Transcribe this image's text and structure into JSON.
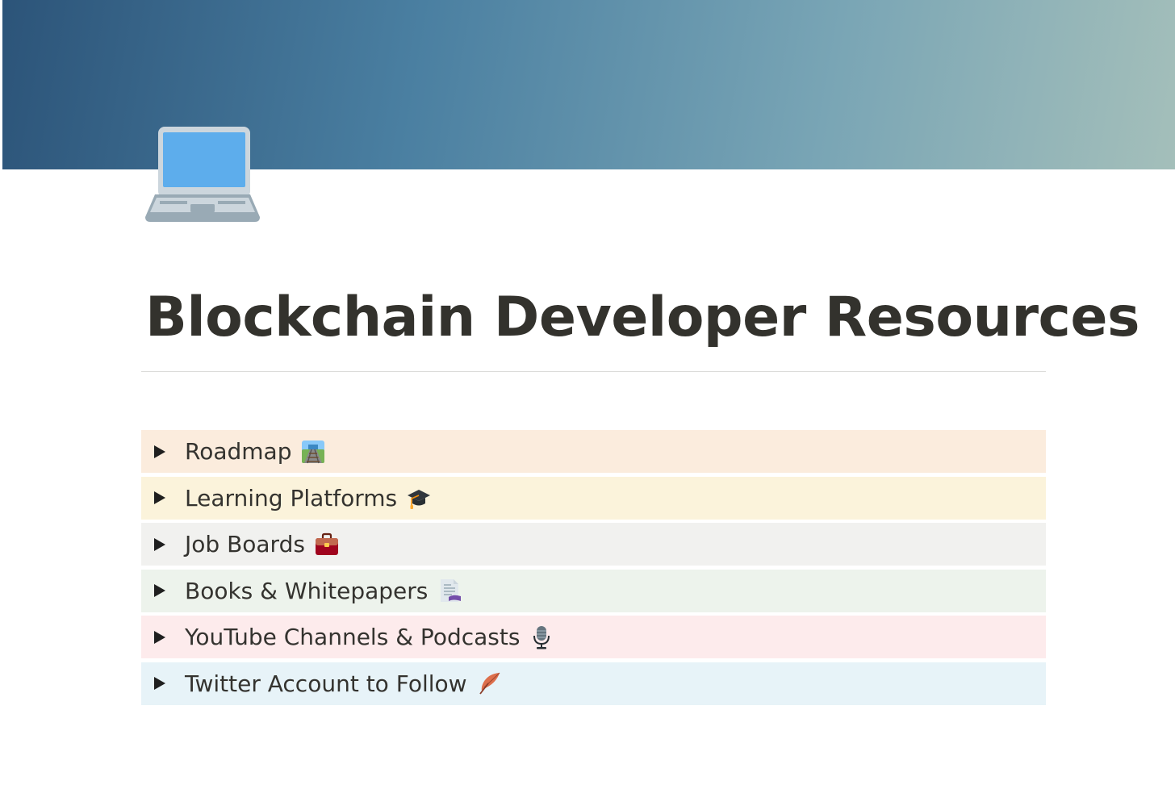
{
  "page": {
    "title": "Blockchain Developer Resources",
    "icon": "laptop-icon"
  },
  "colors": {
    "cover_start": "#2c5479",
    "cover_end": "#a4bfba",
    "title": "#33322d"
  },
  "toggles": [
    {
      "label": "Roadmap",
      "emoji": "railway-track-icon",
      "bg": "#fbecdd"
    },
    {
      "label": "Learning Platforms",
      "emoji": "graduation-cap-icon",
      "bg": "#fbf3db"
    },
    {
      "label": "Job Boards",
      "emoji": "briefcase-icon",
      "bg": "#f1f1ef"
    },
    {
      "label": "Books & Whitepapers",
      "emoji": "page-with-curl-icon",
      "bg": "#edf3ec"
    },
    {
      "label": "YouTube Channels & Podcasts",
      "emoji": "microphone-icon",
      "bg": "#fdebec"
    },
    {
      "label": "Twitter Account to Follow",
      "emoji": "feather-icon",
      "bg": "#e7f3f8"
    }
  ]
}
